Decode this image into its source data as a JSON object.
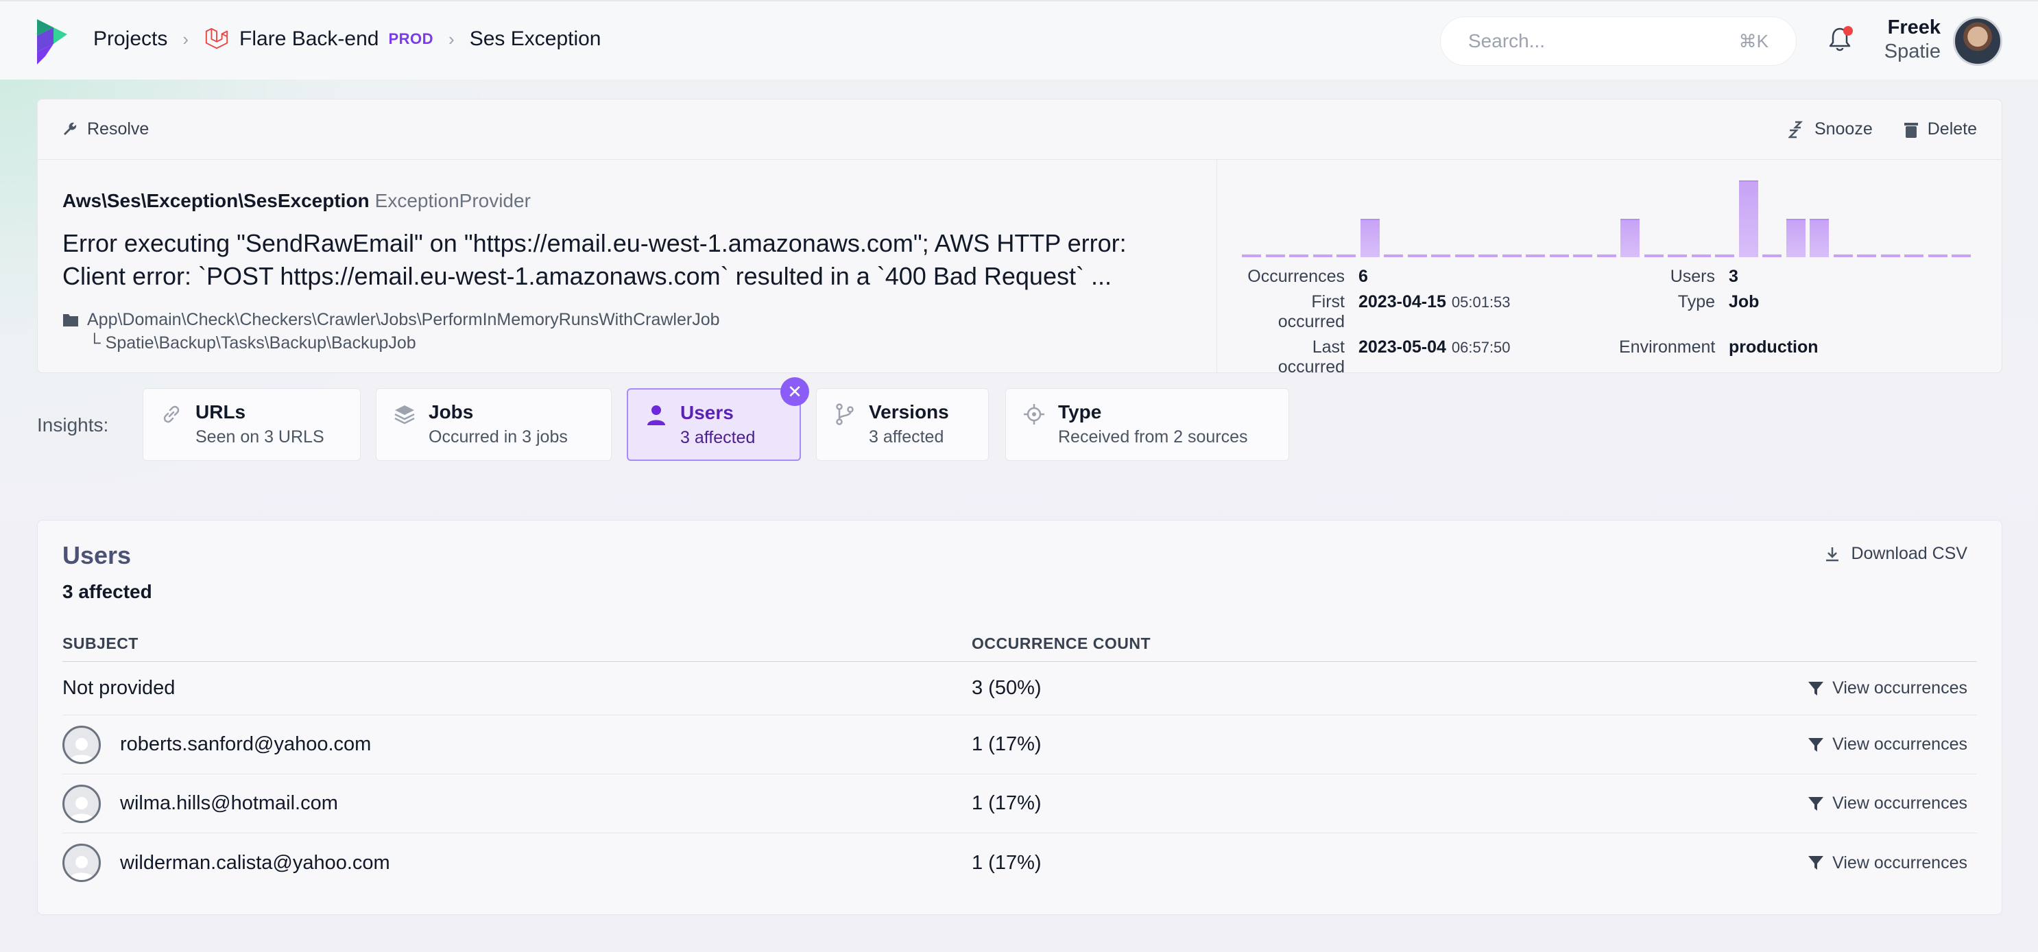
{
  "header": {
    "breadcrumbs": [
      "Projects",
      "Flare Back-end",
      "Ses Exception"
    ],
    "env_badge": "PROD",
    "search_placeholder": "Search...",
    "search_shortcut": "⌘K",
    "user_name": "Freek",
    "user_org": "Spatie"
  },
  "toolbar": {
    "resolve": "Resolve",
    "snooze": "Snooze",
    "delete": "Delete"
  },
  "exception": {
    "class": "Aws\\Ses\\Exception\\SesException",
    "provider": "ExceptionProvider",
    "message_line1": "Error executing \"SendRawEmail\" on \"https://email.eu-west-1.amazonaws.com\"; AWS HTTP error:",
    "message_line2": "Client error: `POST https://email.eu-west-1.amazonaws.com` resulted in a `400 Bad Request` ...",
    "location": "App\\Domain\\Check\\Checkers\\Crawler\\Jobs\\PerformInMemoryRunsWithCrawlerJob",
    "location_sub": "└ Spatie\\Backup\\Tasks\\Backup\\BackupJob"
  },
  "chart_data": {
    "type": "bar",
    "values": [
      0,
      0,
      0,
      0,
      0,
      1,
      0,
      0,
      0,
      0,
      0,
      0,
      0,
      0,
      0,
      0,
      1,
      0,
      0,
      0,
      0,
      2,
      0,
      1,
      1,
      0,
      0,
      0,
      0,
      0,
      0
    ]
  },
  "stats": {
    "occurrences_label": "Occurrences",
    "occurrences": "6",
    "first_label": "First occurred",
    "first_date": "2023-04-15",
    "first_time": "05:01:53",
    "last_label": "Last occurred",
    "last_date": "2023-05-04",
    "last_time": "06:57:50",
    "users_label": "Users",
    "users": "3",
    "type_label": "Type",
    "type": "Job",
    "env_label": "Environment",
    "env": "production"
  },
  "insights": {
    "label": "Insights:",
    "cards": [
      {
        "title": "URLs",
        "sub": "Seen on 3 URLS"
      },
      {
        "title": "Jobs",
        "sub": "Occurred in 3 jobs"
      },
      {
        "title": "Users",
        "sub": "3 affected"
      },
      {
        "title": "Versions",
        "sub": "3 affected"
      },
      {
        "title": "Type",
        "sub": "Received from 2 sources"
      }
    ],
    "close": "✕"
  },
  "users": {
    "title": "Users",
    "count": "3 affected",
    "download": "Download CSV",
    "col_subject": "SUBJECT",
    "col_count": "OCCURRENCE COUNT",
    "view_label": "View occurrences",
    "rows": [
      {
        "subject": "Not provided",
        "count": "3 (50%)"
      },
      {
        "subject": "roberts.sanford@yahoo.com",
        "count": "1 (17%)"
      },
      {
        "subject": "wilma.hills@hotmail.com",
        "count": "1 (17%)"
      },
      {
        "subject": "wilderman.calista@yahoo.com",
        "count": "1 (17%)"
      }
    ]
  }
}
